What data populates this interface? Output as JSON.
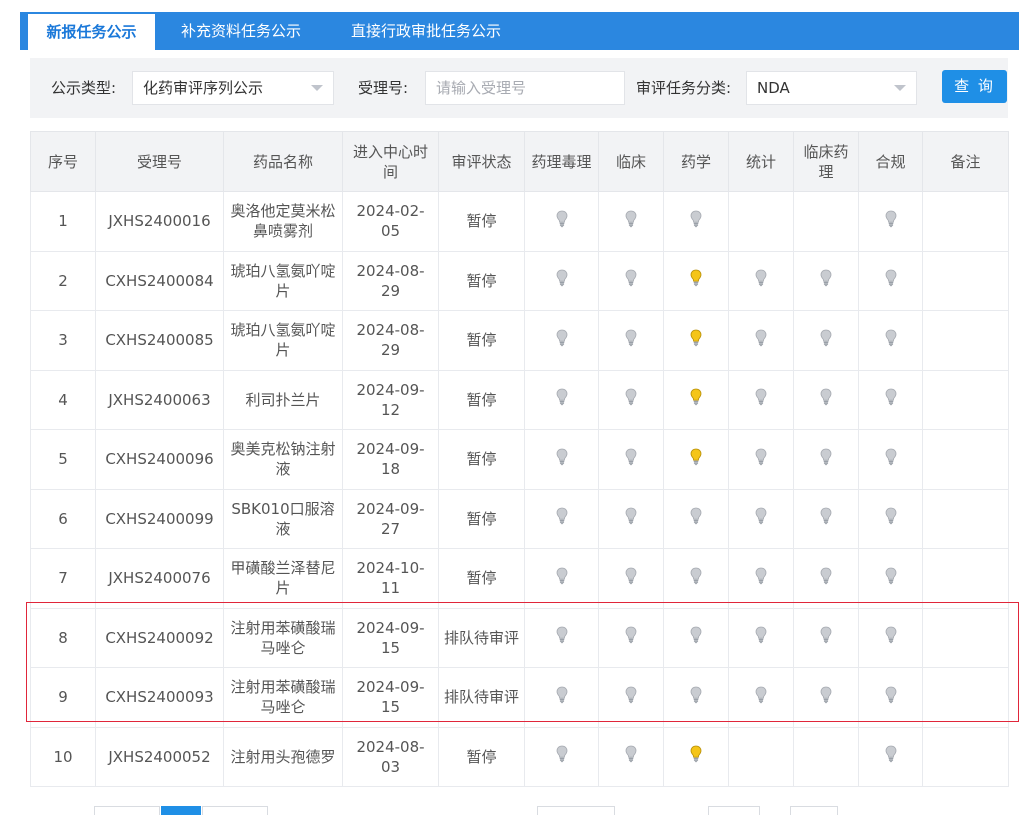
{
  "tabs": [
    {
      "label": "新报任务公示",
      "active": true
    },
    {
      "label": "补充资料任务公示",
      "active": false
    },
    {
      "label": "直接行政审批任务公示",
      "active": false
    }
  ],
  "filters": {
    "type_label": "公示类型:",
    "type_value": "化药审评序列公示",
    "accept_label": "受理号:",
    "accept_placeholder": "请输入受理号",
    "category_label": "审评任务分类:",
    "category_value": "NDA",
    "search_button": "查 询"
  },
  "table": {
    "headers": [
      "序号",
      "受理号",
      "药品名称",
      "进入中心时间",
      "审评状态",
      "药理毒理",
      "临床",
      "药学",
      "统计",
      "临床药理",
      "合规",
      "备注"
    ],
    "rows": [
      {
        "no": "1",
        "id": "JXHS2400016",
        "name": "奥洛他定莫米松鼻喷雾剂",
        "date": "2024-02-05",
        "status": "暂停",
        "lights": [
          "g",
          "g",
          "g",
          "",
          "",
          "g",
          ""
        ]
      },
      {
        "no": "2",
        "id": "CXHS2400084",
        "name": "琥珀八氢氨吖啶片",
        "date": "2024-08-29",
        "status": "暂停",
        "lights": [
          "g",
          "g",
          "y",
          "g",
          "g",
          "g",
          ""
        ]
      },
      {
        "no": "3",
        "id": "CXHS2400085",
        "name": "琥珀八氢氨吖啶片",
        "date": "2024-08-29",
        "status": "暂停",
        "lights": [
          "g",
          "g",
          "y",
          "g",
          "g",
          "g",
          ""
        ]
      },
      {
        "no": "4",
        "id": "JXHS2400063",
        "name": "利司扑兰片",
        "date": "2024-09-12",
        "status": "暂停",
        "lights": [
          "g",
          "g",
          "y",
          "g",
          "g",
          "g",
          ""
        ]
      },
      {
        "no": "5",
        "id": "CXHS2400096",
        "name": "奥美克松钠注射液",
        "date": "2024-09-18",
        "status": "暂停",
        "lights": [
          "g",
          "g",
          "y",
          "g",
          "g",
          "g",
          ""
        ]
      },
      {
        "no": "6",
        "id": "CXHS2400099",
        "name": "SBK010口服溶液",
        "date": "2024-09-27",
        "status": "暂停",
        "lights": [
          "g",
          "g",
          "g",
          "g",
          "g",
          "g",
          ""
        ]
      },
      {
        "no": "7",
        "id": "JXHS2400076",
        "name": "甲磺酸兰泽替尼片",
        "date": "2024-10-11",
        "status": "暂停",
        "lights": [
          "g",
          "g",
          "g",
          "g",
          "g",
          "g",
          ""
        ]
      },
      {
        "no": "8",
        "id": "CXHS2400092",
        "name": "注射用苯磺酸瑞马唑仑",
        "date": "2024-09-15",
        "status": "排队待审评",
        "lights": [
          "g",
          "g",
          "g",
          "g",
          "g",
          "g",
          ""
        ]
      },
      {
        "no": "9",
        "id": "CXHS2400093",
        "name": "注射用苯磺酸瑞马唑仑",
        "date": "2024-09-15",
        "status": "排队待审评",
        "lights": [
          "g",
          "g",
          "g",
          "g",
          "g",
          "g",
          ""
        ]
      },
      {
        "no": "10",
        "id": "JXHS2400052",
        "name": "注射用头孢德罗",
        "date": "2024-08-03",
        "status": "暂停",
        "lights": [
          "g",
          "g",
          "y",
          "",
          "",
          "g",
          ""
        ]
      }
    ]
  },
  "colors": {
    "accent": "#2b87e0",
    "grey_bulb": "#c9ccd1",
    "yellow_bulb": "#f5c518",
    "highlight": "#e0263a"
  }
}
